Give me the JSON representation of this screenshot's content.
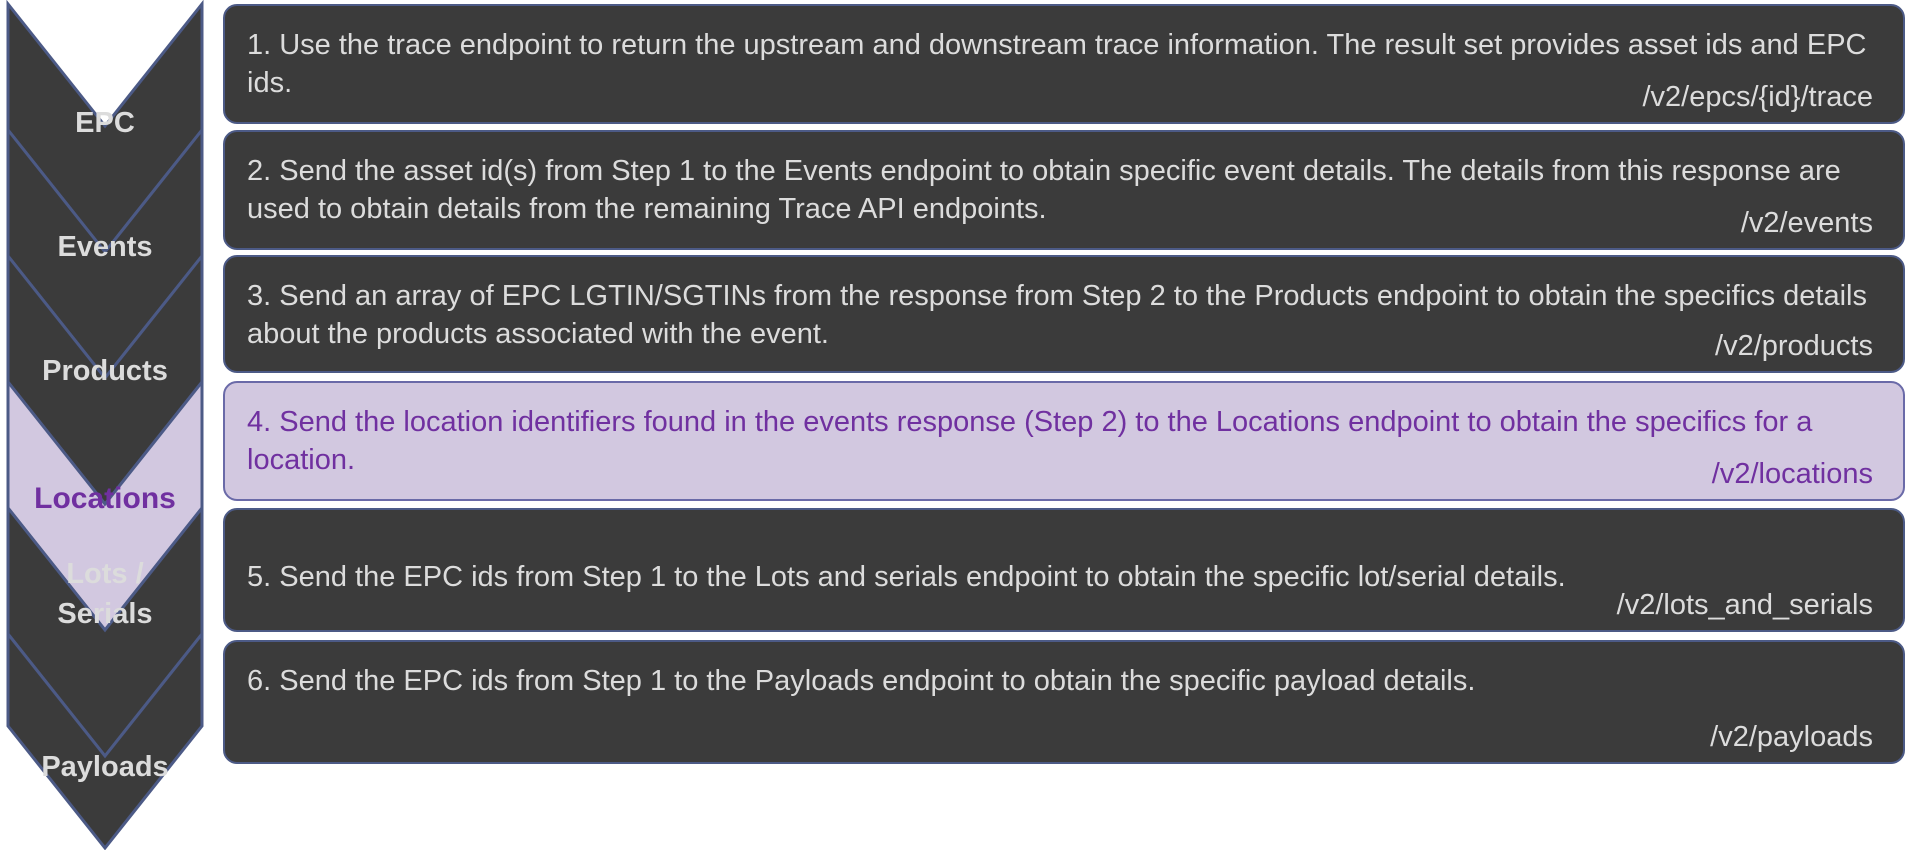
{
  "colors": {
    "chevron_fill": "#3b3b3b",
    "chevron_stroke": "#4c5a86",
    "chevron_label": "#dcdcdc",
    "box_fill": "#3b3b3b",
    "box_text": "#dcdcdc",
    "highlight_fill": "#d2c8e0",
    "highlight_text": "#7030a0"
  },
  "stages": [
    {
      "label_lines": [
        "EPC"
      ],
      "active": false
    },
    {
      "label_lines": [
        "Events"
      ],
      "active": false
    },
    {
      "label_lines": [
        "Products"
      ],
      "active": false
    },
    {
      "label_lines": [
        "Locations"
      ],
      "active": true
    },
    {
      "label_lines": [
        "Lots /",
        "Serials"
      ],
      "active": false
    },
    {
      "label_lines": [
        "Payloads"
      ],
      "active": false
    }
  ],
  "steps": [
    {
      "text": "1. Use the trace endpoint to return the upstream and downstream trace information. The result set provides asset ids and EPC ids.",
      "endpoint": "/v2/epcs/{id}/trace"
    },
    {
      "text": "2. Send the asset id(s) from Step 1 to the Events endpoint to obtain specific event details. The details from this response are used to obtain details from the remaining Trace API endpoints.",
      "endpoint": "/v2/events"
    },
    {
      "text": "3. Send an array of EPC LGTIN/SGTINs from the response from Step 2 to the Products endpoint to obtain the specifics details about the products associated with the event.",
      "endpoint": "/v2/products"
    },
    {
      "text": "4. Send the location identifiers found in the events response (Step 2) to the Locations endpoint to obtain the specifics for a location.",
      "endpoint": "/v2/locations"
    },
    {
      "text": "5. Send the EPC ids from Step 1 to the Lots and serials endpoint to obtain the specific lot/serial details.",
      "endpoint": "/v2/lots_and_serials"
    },
    {
      "text": "6. Send the EPC ids from Step 1 to the Payloads endpoint to obtain the specific payload details.",
      "endpoint": "/v2/payloads"
    }
  ]
}
